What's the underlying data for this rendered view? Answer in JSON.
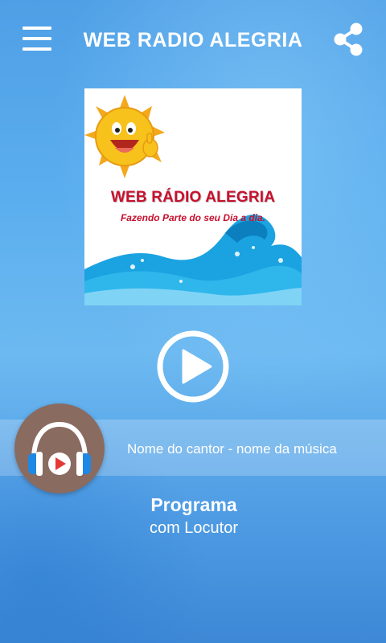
{
  "app": {
    "title": "WEB RADIO ALEGRIA",
    "menu_icon": "hamburger-menu-icon",
    "share_icon": "share-icon"
  },
  "logo": {
    "title": "WEB RÁDIO ALEGRIA",
    "subtitle": "Fazendo Parte do seu Dia a dia.",
    "colors": {
      "text": "#c8102e",
      "sun": "#f7c21b",
      "wave": "#1aa3e0"
    }
  },
  "player": {
    "play_icon": "play-circle-icon",
    "track": "Nome do cantor - nome da música",
    "avatar_icon": "headphones-play-icon"
  },
  "program": {
    "name": "Programa",
    "host": "com Locutor"
  }
}
